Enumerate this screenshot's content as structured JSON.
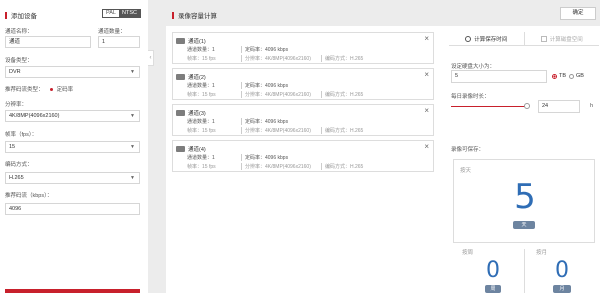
{
  "left_panel": {
    "title": "添加设备",
    "std_pal": "PAL",
    "std_ntsc": "NTSC",
    "channel_name_label": "通道名称：",
    "channel_name_value": "通道",
    "channel_count_label": "通道数量：",
    "channel_count_value": "1",
    "device_type_label": "设备类型：",
    "device_type_value": "DVR",
    "bitrate_type_label": "推荐码流类型：",
    "bitrate_type_value": "定码率",
    "resolution_label": "分辨率：",
    "resolution_value": "4K/8MP(4096x2160)",
    "fps_label": "帧率（fps）：",
    "fps_value": "15",
    "codec_label": "编码方式：",
    "codec_value": "H.265",
    "rec_bitrate_label": "推荐码流（kbps）：",
    "rec_bitrate_value": "4096"
  },
  "main": {
    "title": "录像容量计算",
    "confirm_label": "确定",
    "channels": [
      {
        "name": "通道(1)",
        "count": "通道数量：1",
        "mode": "定码率：4096 kbps",
        "fps": "帧率：15 fps",
        "res": "分辨率：4K/8MP(4096x2160)",
        "codec": "编码方式：H.265"
      },
      {
        "name": "通道(2)",
        "count": "通道数量：1",
        "mode": "定码率：4096 kbps",
        "fps": "帧率：15 fps",
        "res": "分辨率：4K/8MP(4096x2160)",
        "codec": "编码方式：H.265"
      },
      {
        "name": "通道(3)",
        "count": "通道数量：1",
        "mode": "定码率：4096 kbps",
        "fps": "帧率：15 fps",
        "res": "分辨率：4K/8MP(4096x2160)",
        "codec": "编码方式：H.265"
      },
      {
        "name": "通道(4)",
        "count": "通道数量：1",
        "mode": "定码率：4096 kbps",
        "fps": "帧率：15 fps",
        "res": "分辨率：4K/8MP(4096x2160)",
        "codec": "编码方式：H.265"
      }
    ],
    "close_glyph": "×"
  },
  "calc": {
    "tab_time": "计算保存时间",
    "tab_space": "计算磁盘空间",
    "disk_label": "设定硬盘大小为：",
    "disk_value": "5",
    "unit_tb": "TB",
    "unit_gb": "GB",
    "daily_label": "每日录像时长：",
    "daily_value": "24",
    "daily_unit": "h",
    "daily_fraction": 1.0,
    "result_label": "录像可保存：",
    "by_day_label": "按天",
    "days_value": "5",
    "days_unit": "天",
    "by_week_label": "按周",
    "weeks_value": "0",
    "weeks_unit": "周",
    "by_month_label": "按月",
    "months_value": "0",
    "months_unit": "月",
    "accent_color": "#c8202c",
    "number_color": "#2f6db5"
  }
}
